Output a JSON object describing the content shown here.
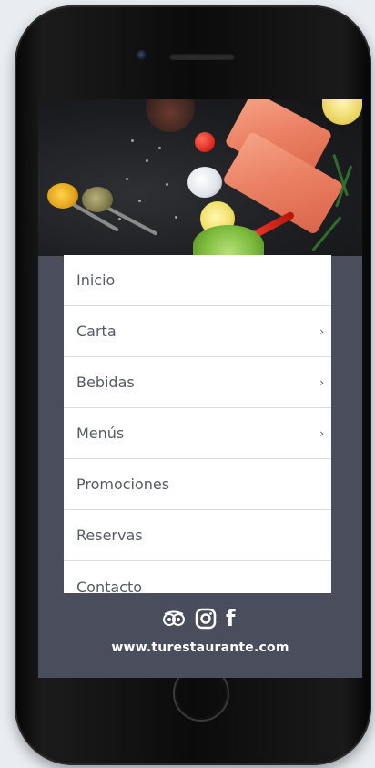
{
  "menu": {
    "items": [
      {
        "label": "Inicio",
        "has_submenu": false,
        "chevron": "›"
      },
      {
        "label": "Carta",
        "has_submenu": true,
        "chevron": "›"
      },
      {
        "label": "Bebidas",
        "has_submenu": true,
        "chevron": "›"
      },
      {
        "label": "Menús",
        "has_submenu": true,
        "chevron": "›"
      },
      {
        "label": "Promociones",
        "has_submenu": false,
        "chevron": "›"
      },
      {
        "label": "Reservas",
        "has_submenu": false,
        "chevron": "›"
      },
      {
        "label": "Contacto",
        "has_submenu": false,
        "chevron": "›"
      }
    ]
  },
  "footer": {
    "social_icons": [
      "tripadvisor-icon",
      "instagram-icon",
      "facebook-icon"
    ],
    "facebook_glyph": "f",
    "url": "www.turestaurante.com"
  },
  "colors": {
    "screen_background": "#4a4d5c",
    "menu_background": "#ffffff",
    "menu_text": "#555b66",
    "footer_text": "#ffffff"
  }
}
